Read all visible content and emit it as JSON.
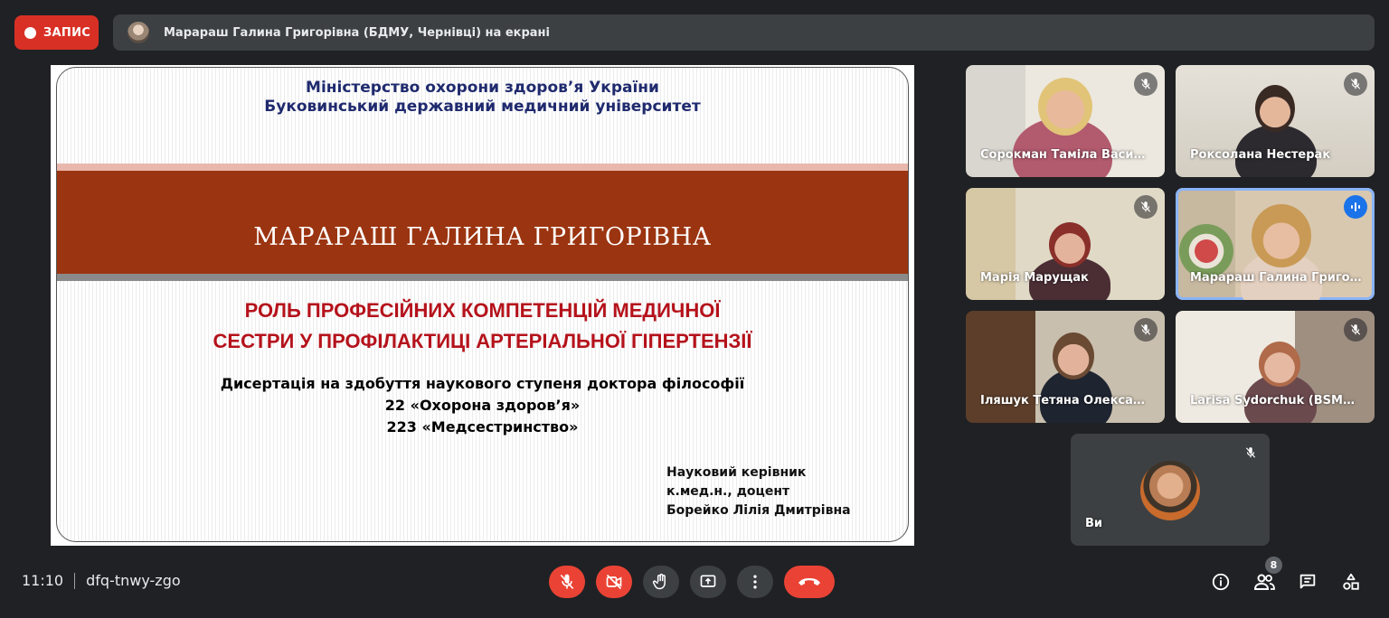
{
  "recording": {
    "label": "ЗАПИС"
  },
  "presenting": {
    "text": "Марараш Галина Григорівна (БДМУ, Чернівці) на екрані"
  },
  "slide": {
    "header_line1": "Міністерство охорони здоров’я України",
    "header_line2": "Буковинський державний медичний університет",
    "author": "МАРАРАШ ГАЛИНА ГРИГОРІВНА",
    "topic_line1": "РОЛЬ ПРОФЕСІЙНИХ КОМПЕТЕНЦІЙ МЕДИЧНОЇ",
    "topic_line2": "СЕСТРИ У ПРОФІЛАКТИЦІ АРТЕРІАЛЬНОЇ ГІПЕРТЕНЗІЇ",
    "degree_line1": "Дисертація на здобуття наукового ступеня доктора філософії",
    "degree_line2": "22 «Охорона здоров’я»",
    "degree_line3": "223 «Медсестринство»",
    "supervisor_line1": "Науковий керівник",
    "supervisor_line2": "к.мед.н., доцент",
    "supervisor_line3": "Борейко Лілія Дмитрівна"
  },
  "participants": [
    {
      "name": "Сорокман Таміла Василівна",
      "muted": true
    },
    {
      "name": "Роксолана Нестерак",
      "muted": true
    },
    {
      "name": "Марія Марущак",
      "muted": true
    },
    {
      "name": "Марараш Галина Григорівна",
      "muted": false,
      "speaking": true
    },
    {
      "name": "Іляшук Тетяна Олександрівна",
      "muted": true
    },
    {
      "name": "Larisa Sydorchuk (BSMU, Chernivtsi)",
      "muted": true
    },
    {
      "name": "Ви",
      "muted": true,
      "self": true
    }
  ],
  "footer": {
    "time": "11:10",
    "meeting_code": "dfq-tnwy-zgo",
    "people_count": "8"
  },
  "colors": {
    "background": "#202124",
    "record_red": "#d93025",
    "control_gray": "#3c4043",
    "danger_red": "#ea4335",
    "speaking_blue": "#1a73e8",
    "slide_band": "#9b3410",
    "slide_topic_red": "#b5121b",
    "slide_header_blue": "#1f2a6e"
  },
  "icons": {
    "controls": [
      "mic-off-icon",
      "video-off-icon",
      "raise-hand-icon",
      "present-screen-icon",
      "more-options-icon",
      "hang-up-icon"
    ],
    "side": [
      "info-icon",
      "people-icon",
      "chat-icon",
      "activities-icon"
    ]
  }
}
